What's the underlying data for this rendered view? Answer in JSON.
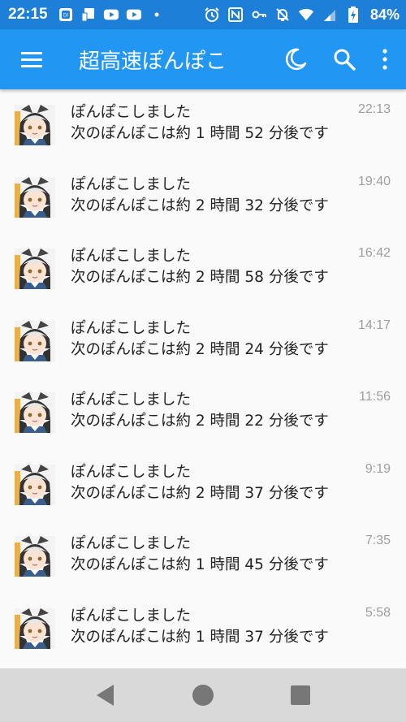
{
  "status_bar": {
    "time": "22:15",
    "battery_percent": "84%",
    "icons_left": [
      "photo-notification-icon",
      "cast-notification-icon",
      "youtube-notification-icon",
      "youtube-notification-icon",
      "dot-icon"
    ],
    "icons_right": [
      "alarm-icon",
      "nfc-icon",
      "vpn-key-icon",
      "muted-bell-icon",
      "wifi-icon",
      "signal-icon",
      "battery-charging-icon"
    ]
  },
  "app_bar": {
    "title": "超高速ぽんぽこ",
    "icons": [
      "menu-icon",
      "moon-icon",
      "search-icon",
      "more-vert-icon"
    ]
  },
  "notifications": [
    {
      "title": "ぽんぽこしました",
      "body": "次のぽんぽこは約 1 時間 52 分後です",
      "time": "22:13"
    },
    {
      "title": "ぽんぽこしました",
      "body": "次のぽんぽこは約 2 時間 32 分後です",
      "time": "19:40"
    },
    {
      "title": "ぽんぽこしました",
      "body": "次のぽんぽこは約 2 時間 58 分後です",
      "time": "16:42"
    },
    {
      "title": "ぽんぽこしました",
      "body": "次のぽんぽこは約 2 時間 24 分後です",
      "time": "14:17"
    },
    {
      "title": "ぽんぽこしました",
      "body": "次のぽんぽこは約 2 時間 22 分後です",
      "time": "11:56"
    },
    {
      "title": "ぽんぽこしました",
      "body": "次のぽんぽこは約 2 時間 37 分後です",
      "time": "9:19"
    },
    {
      "title": "ぽんぽこしました",
      "body": "次のぽんぽこは約 1 時間 45 分後です",
      "time": "7:35"
    },
    {
      "title": "ぽんぽこしました",
      "body": "次のぽんぽこは約 1 時間 37 分後です",
      "time": "5:58"
    }
  ],
  "nav_bar": {
    "icons": [
      "back-icon",
      "home-icon",
      "recents-icon"
    ]
  },
  "colors": {
    "status_bar": "#1e7fd8",
    "app_bar": "#2196f3",
    "nav_bar": "#d9d9d9",
    "time_text": "#9e9e9e"
  }
}
